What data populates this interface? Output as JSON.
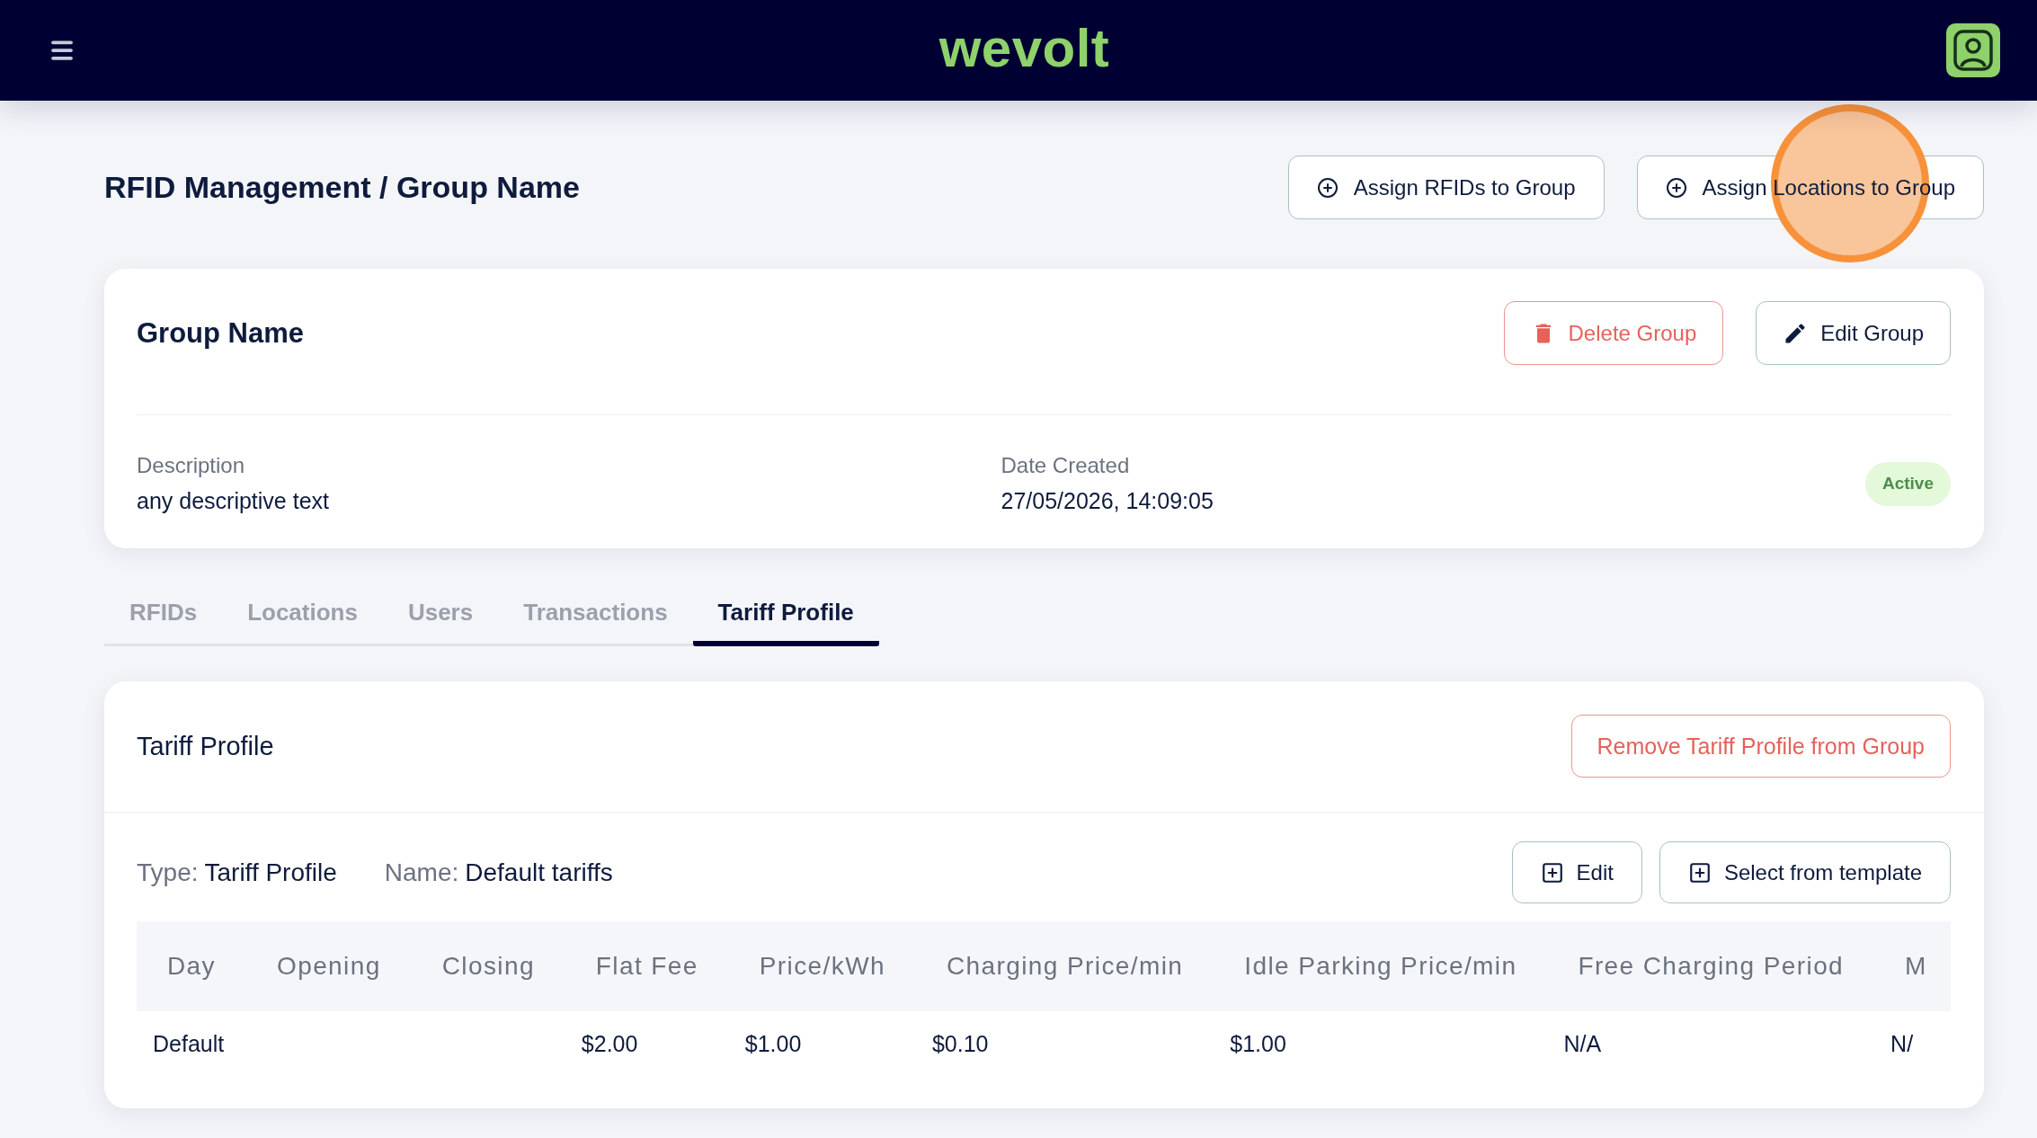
{
  "top_bar": {
    "logo": "wevolt"
  },
  "page": {
    "title": "RFID Management / Group Name",
    "actions": [
      {
        "label": "Assign RFIDs to Group",
        "click_marker": false
      },
      {
        "label": "Assign Locations to Group",
        "click_marker": true
      }
    ]
  },
  "group_card": {
    "title": "Group Name",
    "actions": [
      {
        "label": "Delete Group",
        "kind": "danger"
      },
      {
        "label": "Edit Group",
        "kind": "edit"
      }
    ],
    "fields": [
      {
        "label": "Description",
        "value": "any descriptive text"
      },
      {
        "label": "Date Created",
        "value": "27/05/2026, 14:09:05"
      }
    ],
    "status": "Active"
  },
  "tabs": [
    {
      "label": "RFIDs",
      "selected": false
    },
    {
      "label": "Locations",
      "selected": false
    },
    {
      "label": "Users",
      "selected": false
    },
    {
      "label": "Transactions",
      "selected": false
    },
    {
      "label": "Tariff Profile",
      "selected": true
    }
  ],
  "tariff_card": {
    "title": "Tariff Profile",
    "remove_button": "Remove Tariff Profile from Group",
    "meta": [
      {
        "label": "Type:",
        "value": "Tariff Profile"
      },
      {
        "label": "Name:",
        "value": "Default tariffs"
      }
    ],
    "actions": [
      {
        "label": "Edit"
      },
      {
        "label": "Select from template"
      }
    ],
    "table": {
      "columns": [
        "Day",
        "Opening",
        "Closing",
        "Flat Fee",
        "Price/kWh",
        "Charging Price/min",
        "Idle Parking Price/min",
        "Free Charging Period",
        "M"
      ],
      "rows": [
        {
          "cells": [
            "Default",
            null,
            null,
            "$2.00",
            "$1.00",
            "$0.10",
            "$1.00",
            "N/A",
            "N/"
          ]
        }
      ]
    }
  }
}
